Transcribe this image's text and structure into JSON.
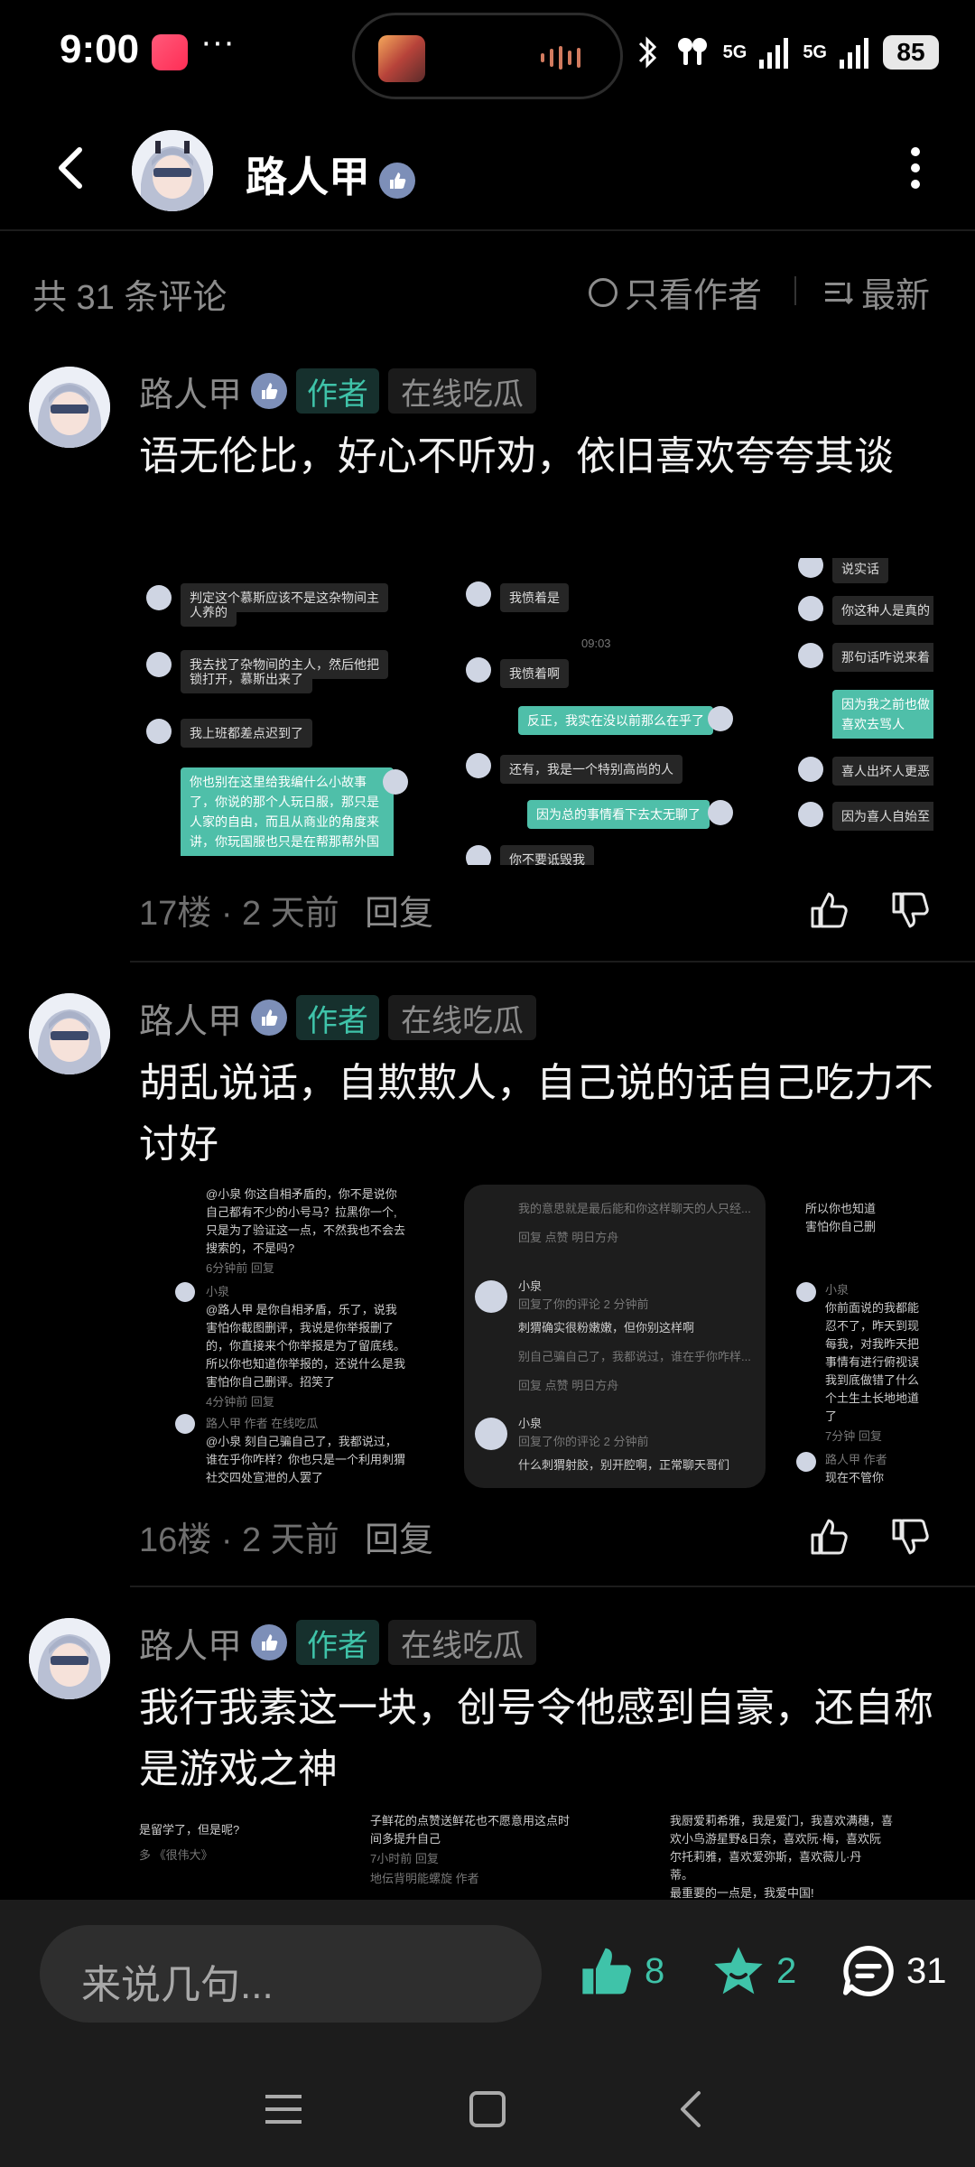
{
  "status_bar": {
    "time": "9:00",
    "more": "···",
    "signal_1": "5G",
    "signal_2": "5G",
    "battery": "85"
  },
  "header": {
    "title": "路人甲"
  },
  "sort_bar": {
    "count_label": "共 31 条评论",
    "only_author": "只看作者",
    "newest": "最新"
  },
  "comments": [
    {
      "name": "路人甲",
      "author_tag": "作者",
      "status_tag": "在线吃瓜",
      "text": "语无伦比，好心不听劝，依旧喜欢夸夸其谈",
      "floor": "17楼 · 2 天前",
      "reply": "回复",
      "shots": [
        [
          "判定这个慕斯应该不是这杂物间主",
          "人养的",
          "我去找了杂物间的主人，然后他把",
          "锁打开，慕斯出来了",
          "我上班都差点迟到了",
          "你也别在这里给我编什么小故事",
          "了，你说的那个人玩日服，那只是",
          "人家的自由，而且从商业的角度来",
          "讲，你玩国服也只是在帮那帮外国"
        ],
        [
          "我愤着是",
          "09:03",
          "我愤着啊",
          "反正，我实在没以前那么在乎了",
          "还有，我是一个特别高尚的人",
          "因为总的事情看下去太无聊了",
          "你不要诋毁我"
        ],
        [
          "说实话",
          "你这种人是真的",
          "那句话咋说来着",
          "因为我之前也做",
          "喜欢去骂人",
          "喜人出坏人更恶",
          "因为喜人自始至"
        ]
      ]
    },
    {
      "name": "路人甲",
      "author_tag": "作者",
      "status_tag": "在线吃瓜",
      "text": "胡乱说话，自欺欺人，自己说的话自己吃力不讨好",
      "floor": "16楼 · 2 天前",
      "reply": "回复",
      "shots": [
        [
          "@小泉  你这自相矛盾的，你不是说你",
          "自己都有不少的小号马？拉黑你一个,",
          "只是为了验证这一点，不然我也不会去",
          "搜索的，不是吗?",
          "6分钟前  回复",
          "小泉",
          "@路人甲  是你自相矛盾，乐了，说我",
          "害怕你截图删评，我说是你举报删了",
          "的，你直接来个你举报是为了留底线。",
          "所以你也知道你举报的，还说什么是我",
          "害怕你自己删评。招笑了",
          "4分钟前  回复",
          "路人甲   作者  在线吃瓜",
          "@小泉  刻自己骗自己了，我都说过，",
          "谁在乎你咋样？你也只是一个利用刺猬",
          "社交四处宣泄的人罢了"
        ],
        [
          "我的意思就是最后能和你这样聊天的人只经...",
          "回复   点赞                   明日方舟",
          "小泉",
          "回复了你的评论 2 分钟前",
          "刺猬确实很粉嫩嫩，但你别这样啊",
          "别自己骗自己了，我都说过，谁在乎你咋样...",
          "回复   点赞                   明日方舟",
          "小泉",
          "回复了你的评论 2 分钟前",
          "什么刺猬射胶，别开腔啊，正常聊天哥们"
        ],
        [
          "所以你也知道",
          "害怕你自己删",
          "小泉",
          "你前面说的我都能",
          "忍不了，昨天到现",
          "每我，对我昨天把",
          "事情有进行俯视误",
          "我到底做错了什么",
          "个土生土长地地道",
          "了",
          "7分钟  回复",
          "路人甲   作者",
          "现在不管你"
        ]
      ]
    },
    {
      "name": "路人甲",
      "author_tag": "作者",
      "status_tag": "在线吃瓜",
      "text": "我行我素这一块，创号令他感到自豪，还自称是游戏之神",
      "floor": "",
      "reply": "",
      "shots": [
        [
          "是留学了，但是呢?",
          "多   《很伟大》"
        ],
        [
          "子鲜花的点赞送鲜花也不愿意用这点时",
          "间多提升自己",
          "7小时前  回复",
          "地伝背明能螺旋   作者"
        ],
        [
          "我厨爱莉希雅，我是爱门，我喜欢满穗，喜",
          "欢小鸟游星野&日奈，喜欢阮·梅，喜欢阮",
          "尔托莉雅，喜欢爱弥斯，喜欢薇儿·丹",
          "蒂。",
          "最重要的一点是，我爱中国!"
        ]
      ]
    }
  ],
  "bottom_bar": {
    "placeholder": "来说几句...",
    "like_count": "8",
    "fav_count": "2",
    "comment_count": "31"
  },
  "colors": {
    "accent": "#3fc3a9",
    "background": "#000000",
    "muted": "#8c8c8c"
  },
  "icons": [
    "back-icon",
    "verify-icon",
    "more-icon",
    "circle-icon",
    "sort-icon",
    "thumb-up-icon",
    "thumb-down-icon",
    "like-icon",
    "star-icon",
    "comment-icon",
    "menu-icon",
    "home-icon",
    "nav-back-icon"
  ]
}
